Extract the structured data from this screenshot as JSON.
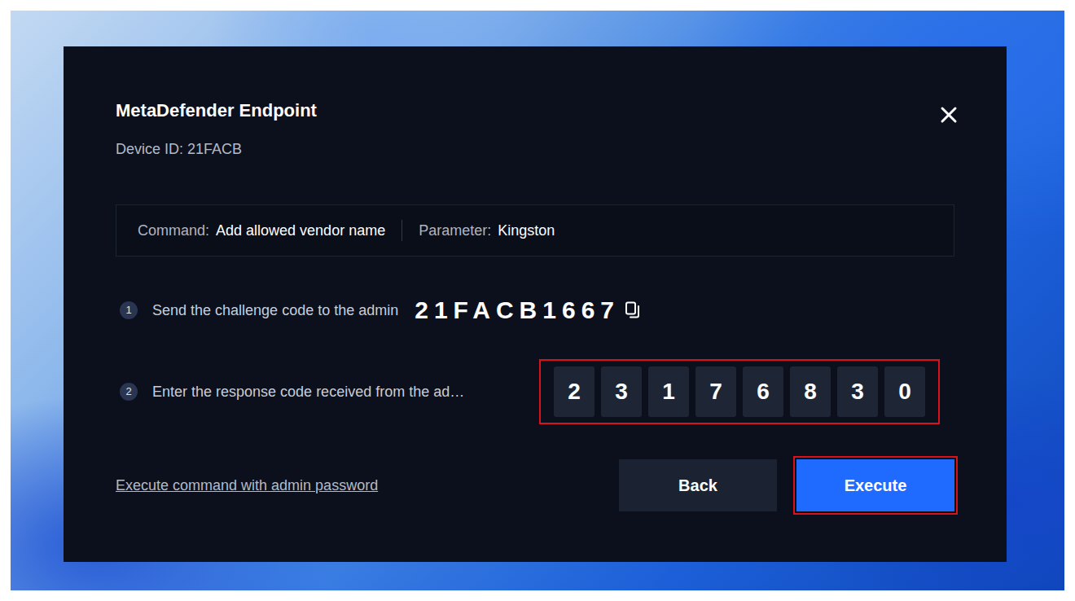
{
  "dialog": {
    "title": "MetaDefender Endpoint",
    "device_id": "Device ID: 21FACB"
  },
  "command": {
    "label": "Command:",
    "value": "Add allowed vendor name",
    "parameter_label": "Parameter:",
    "parameter_value": "Kingston"
  },
  "challenge": {
    "number": "1",
    "label": "Send the challenge code to the admin",
    "code": "21FACB1667"
  },
  "response": {
    "number": "2",
    "label": "Enter the response code received from the ad…",
    "digits": [
      "2",
      "3",
      "1",
      "7",
      "6",
      "8",
      "3",
      "0"
    ],
    "highlighted": true
  },
  "link": "Execute command with admin password",
  "buttons": [
    {
      "label": "Back",
      "kind": "secondary",
      "highlighted": false
    },
    {
      "label": "Execute",
      "kind": "primary",
      "highlighted": true
    }
  ]
}
